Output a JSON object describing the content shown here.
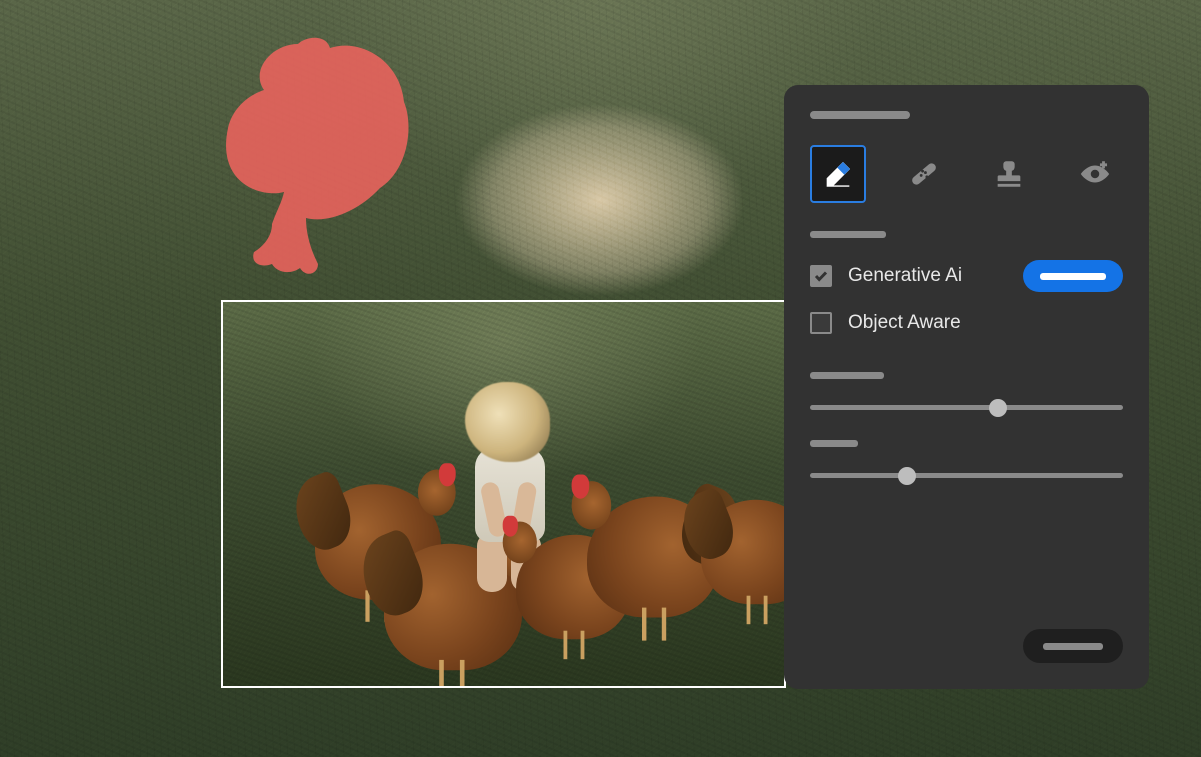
{
  "panel": {
    "tools": [
      {
        "name": "eraser",
        "selected": true
      },
      {
        "name": "healing-brush",
        "selected": false
      },
      {
        "name": "clone-stamp",
        "selected": false
      },
      {
        "name": "red-eye",
        "selected": false
      }
    ],
    "options": {
      "generative_ai": {
        "label": "Generative Ai",
        "checked": true
      },
      "object_aware": {
        "label": "Object Aware",
        "checked": false
      }
    },
    "sliders": {
      "slider1_value": 60,
      "slider2_value": 31
    }
  }
}
